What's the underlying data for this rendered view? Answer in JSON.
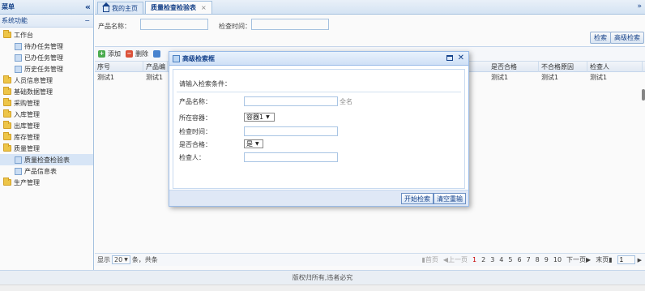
{
  "sidebar": {
    "title": "菜单",
    "collapse_glyph": "«",
    "section": "系统功能",
    "section_toggle": "−",
    "items": [
      {
        "label": "工作台",
        "level": 0,
        "icon": "folder-icon"
      },
      {
        "label": "待办任务管理",
        "level": 1,
        "icon": "page-icon"
      },
      {
        "label": "已办任务管理",
        "level": 1,
        "icon": "page-icon"
      },
      {
        "label": "历史任务管理",
        "level": 1,
        "icon": "page-icon"
      },
      {
        "label": "人员信息管理",
        "level": 0,
        "icon": "folder-icon"
      },
      {
        "label": "基础数据管理",
        "level": 0,
        "icon": "folder-icon"
      },
      {
        "label": "采购管理",
        "level": 0,
        "icon": "folder-icon"
      },
      {
        "label": "入库管理",
        "level": 0,
        "icon": "folder-icon"
      },
      {
        "label": "出库管理",
        "level": 0,
        "icon": "folder-icon"
      },
      {
        "label": "库存管理",
        "level": 0,
        "icon": "folder-icon"
      },
      {
        "label": "质量管理",
        "level": 0,
        "icon": "folder-icon"
      },
      {
        "label": "质量检查检验表",
        "level": 1,
        "icon": "page-icon"
      },
      {
        "label": "产品信息表",
        "level": 1,
        "icon": "page-icon"
      },
      {
        "label": "生产管理",
        "level": 0,
        "icon": "folder-icon"
      }
    ]
  },
  "tabs": [
    {
      "label": "我的主页"
    },
    {
      "label": "质量检查检验表",
      "close": "×"
    }
  ],
  "tab_menu_glyph": "»",
  "search": {
    "product_name_label": "产品名称：",
    "check_time_label": "检查时间：",
    "search_button": "检索",
    "advanced_button": "高级检索"
  },
  "toolbar": {
    "add": "添加",
    "delete": "删除"
  },
  "grid": {
    "columns_left": [
      "序号",
      "产品编"
    ],
    "columns_right": [
      "是否合格",
      "不合格原因",
      "检查人"
    ],
    "rows": [
      {
        "left": [
          "测试1",
          "测试1"
        ],
        "right": [
          "测试1",
          "测试1",
          "测试1"
        ]
      }
    ]
  },
  "pager": {
    "show": "显示",
    "page_size": "20",
    "unit": "条，共条",
    "first": "首页",
    "prev": "上一页",
    "pages": [
      "1",
      "2",
      "3",
      "4",
      "5",
      "6",
      "7",
      "8",
      "9",
      "10"
    ],
    "current_page": "1",
    "next": "下一页",
    "last": "末页",
    "jump_value": "1"
  },
  "footer": "版权归所有,违者必究",
  "modal": {
    "title": "高级检索框",
    "prompt": "请输入检索条件：",
    "fields": {
      "product_name": "产品名称：",
      "product_hint": "全名",
      "container": "所在容器：",
      "container_value": "容器1",
      "check_time": "检查时间：",
      "qualified": "是否合格：",
      "qualified_value": "是",
      "inspector": "检查人："
    },
    "start_button": "开始检索",
    "clear_button": "清空重输",
    "colors": {
      "header": "#cfe0f6",
      "border": "#99bbe8"
    }
  },
  "colors": {
    "accent": "#15428b",
    "border": "#a9c5e4",
    "current_page": "#cc0000"
  }
}
